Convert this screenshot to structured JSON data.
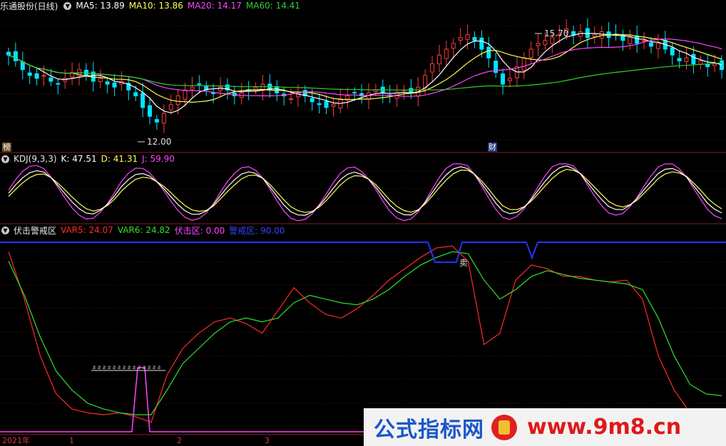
{
  "main_panel": {
    "title": "乐通股份(日线)",
    "ma5": "MA5: 13.89",
    "ma10": "MA10: 13.86",
    "ma20": "MA20: 14.17",
    "ma60": "MA60: 14.41",
    "high_mark": "15.70",
    "low_mark": "12.00",
    "badge_bang": "榜",
    "badge_cai": "财"
  },
  "kdj_panel": {
    "name": "KDJ(9,3,3)",
    "k": "K: 47.51",
    "d": "D: 41.31",
    "j": "J: 59.90"
  },
  "ambush_panel": {
    "name": "伏击警戒区",
    "var5": "VAR5: 24.07",
    "var6": "VAR6: 24.82",
    "ambush": "伏击区: 0.00",
    "warning": "警戒区: 90.00",
    "sell_mark": "卖"
  },
  "x_axis": {
    "year": "2021年",
    "ticks": [
      "1",
      "2",
      "3"
    ]
  },
  "watermark": {
    "cn": "公式指标网",
    "url": "www.9m8.cn"
  },
  "colors": {
    "up": "#ff3b3b",
    "down": "#00e5ff",
    "ma5": "#ffffff",
    "ma10": "#ffff55",
    "ma20": "#ff44ff",
    "ma60": "#33cc33",
    "var5": "#ff2a2a",
    "var6": "#33dd33",
    "ambush": "#ff44ff",
    "warning": "#2233ff"
  },
  "chart_data": [
    {
      "type": "candlestick",
      "title": "乐通股份(日线)",
      "series": [
        {
          "name": "MA5",
          "value": 13.89
        },
        {
          "name": "MA10",
          "value": 13.86
        },
        {
          "name": "MA20",
          "value": 14.17
        },
        {
          "name": "MA60",
          "value": 14.41
        }
      ],
      "annotations": [
        {
          "label": "15.70",
          "kind": "high"
        },
        {
          "label": "12.00",
          "kind": "low"
        }
      ],
      "closes": [
        14.6,
        14.4,
        14.1,
        13.9,
        13.8,
        13.9,
        13.7,
        13.6,
        13.8,
        14.0,
        14.1,
        13.9,
        13.7,
        13.8,
        13.6,
        13.5,
        13.7,
        13.4,
        13.2,
        12.8,
        12.5,
        12.3,
        12.6,
        12.9,
        13.2,
        13.4,
        13.5,
        13.6,
        13.4,
        13.3,
        13.5,
        13.4,
        13.2,
        13.3,
        13.4,
        13.5,
        13.6,
        13.4,
        13.3,
        13.2,
        13.1,
        13.3,
        13.2,
        13.0,
        12.9,
        12.8,
        12.9,
        13.1,
        13.2,
        13.3,
        13.2,
        13.3,
        13.4,
        13.3,
        13.2,
        13.3,
        13.4,
        13.3,
        13.5,
        13.9,
        14.3,
        14.6,
        14.8,
        15.0,
        15.2,
        15.3,
        15.1,
        14.8,
        14.5,
        14.0,
        13.6,
        13.8,
        14.2,
        14.5,
        14.8,
        15.0,
        15.1,
        15.2,
        15.3,
        15.5,
        15.3,
        15.4,
        15.2,
        15.3,
        15.4,
        15.2,
        15.3,
        15.1,
        15.2,
        15.0,
        15.1,
        14.9,
        15.0,
        14.8,
        14.6,
        14.4,
        14.5,
        14.3,
        14.4,
        14.2,
        14.3,
        14.1
      ]
    },
    {
      "type": "line",
      "title": "KDJ(9,3,3)",
      "series": [
        {
          "name": "K",
          "value": 47.51
        },
        {
          "name": "D",
          "value": 41.31
        },
        {
          "name": "J",
          "value": 59.9
        }
      ]
    },
    {
      "type": "line",
      "title": "伏击警戒区",
      "series": [
        {
          "name": "VAR5",
          "value": 24.07
        },
        {
          "name": "VAR6",
          "value": 24.82
        },
        {
          "name": "伏击区",
          "value": 0.0
        },
        {
          "name": "警戒区",
          "value": 90.0
        }
      ]
    }
  ]
}
